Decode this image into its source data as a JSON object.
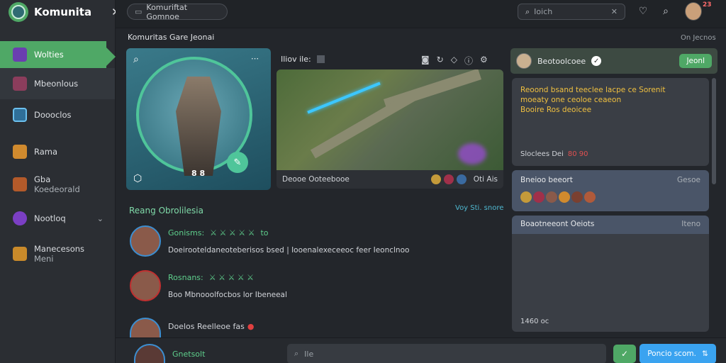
{
  "app": {
    "title": "Komunita"
  },
  "sidebar": {
    "items": [
      {
        "label": "Wolties",
        "icon": "sparkle-icon",
        "active": true
      },
      {
        "label": "Mbeonlous",
        "icon": "game-tile-icon"
      },
      {
        "label": "Doooclos",
        "icon": "monitor-icon"
      },
      {
        "label": "Rama",
        "icon": "sword-icon"
      },
      {
        "label": "Gba",
        "sub": "Koedeorald",
        "icon": "bird-icon"
      },
      {
        "label": "Nootloq",
        "icon": "purple-orb-icon",
        "expand": true
      },
      {
        "label": "Manecesons",
        "sub": "Meni",
        "icon": "flag-icon"
      }
    ]
  },
  "header": {
    "community_pill": "Komuriftat Gomnoe",
    "search_placeholder": "Ioich",
    "notif_count": "23"
  },
  "content": {
    "section_title": "Komuritas Gare Jeonai",
    "section_right": "On Jecnos",
    "hero_level": "8 8",
    "media_title": "Iliov ile:",
    "media_caption": "Deooe Ooteebooe",
    "media_right": "Oti Ais",
    "reading_title": "Reang Obrolilesia",
    "reading_right": "Voy Sti. snore",
    "messages": [
      {
        "name": "Gonisms:",
        "extra": "to",
        "text": "Doeirooteldaneoteberisos bsed | Iooenalexeceeoc feer Ieonclnoo"
      },
      {
        "name": "Rosnans:",
        "extra": "",
        "text": "Boo Mbnooolfocbos lor Ibeneeal"
      },
      {
        "name": "Doelos Reelleoe fas",
        "extra": "",
        "text": ""
      }
    ],
    "composer_user": "Gnetsolt",
    "composer_placeholder": "Ile",
    "send_label": "Poncio scom."
  },
  "panel": {
    "user": "Beotoolcoee",
    "join_label": "Jeonl",
    "announcement": "Reoond bsand teeclee lacpe ce Sorenit\nmoeaty one ceoloe ceaeon\nBooire Ros deoicee",
    "announcement_footer": "Sloclees Dei",
    "announcement_count": "80 90",
    "members_title": "Bneioo beeort",
    "members_right": "Gesoe",
    "threads_title": "Boaotneeont Oeiots",
    "threads_right": "Iteno",
    "bottom_count": "1460 oc"
  },
  "colors": {
    "accent": "#4fa866",
    "panel": "#3a3e45",
    "link": "#5ecf8c",
    "send": "#3aa3f0"
  }
}
